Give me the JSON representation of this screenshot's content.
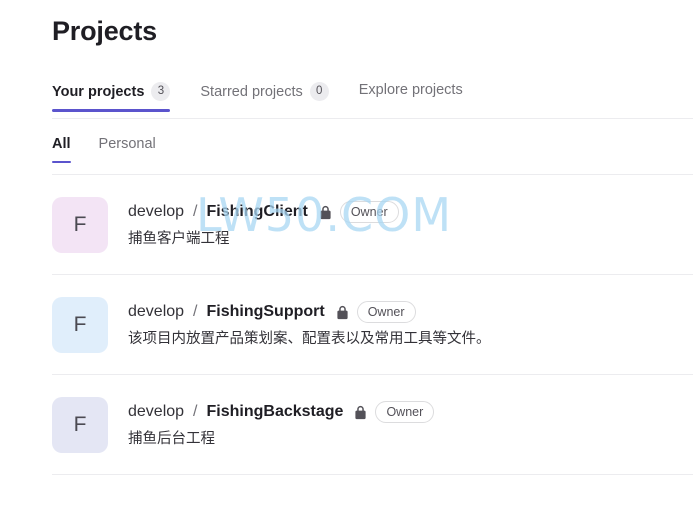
{
  "page": {
    "title": "Projects"
  },
  "primary_tabs": [
    {
      "label": "Your projects",
      "badge": "3",
      "active": true
    },
    {
      "label": "Starred projects",
      "badge": "0",
      "active": false
    },
    {
      "label": "Explore projects",
      "badge": null,
      "active": false
    }
  ],
  "secondary_tabs": [
    {
      "label": "All",
      "active": true
    },
    {
      "label": "Personal",
      "active": false
    }
  ],
  "projects": [
    {
      "avatar_letter": "F",
      "avatar_color": "#f3e4f5",
      "namespace": "develop",
      "separator": "/",
      "name": "FishingClient",
      "visibility_icon": "lock-icon",
      "role_badge": "Owner",
      "description": "捕鱼客户端工程"
    },
    {
      "avatar_letter": "F",
      "avatar_color": "#e0eefb",
      "namespace": "develop",
      "separator": "/",
      "name": "FishingSupport",
      "visibility_icon": "lock-icon",
      "role_badge": "Owner",
      "description": "该项目内放置产品策划案、配置表以及常用工具等文件。"
    },
    {
      "avatar_letter": "F",
      "avatar_color": "#e4e6f4",
      "namespace": "develop",
      "separator": "/",
      "name": "FishingBackstage",
      "visibility_icon": "lock-icon",
      "role_badge": "Owner",
      "description": "捕鱼后台工程"
    }
  ],
  "watermark": {
    "text": "LW50.COM",
    "color": "#a9d7f3"
  },
  "theme": {
    "accent": "#5b54cd",
    "text_primary": "#1f1e24",
    "text_muted": "#737278",
    "divider": "#ececef"
  }
}
